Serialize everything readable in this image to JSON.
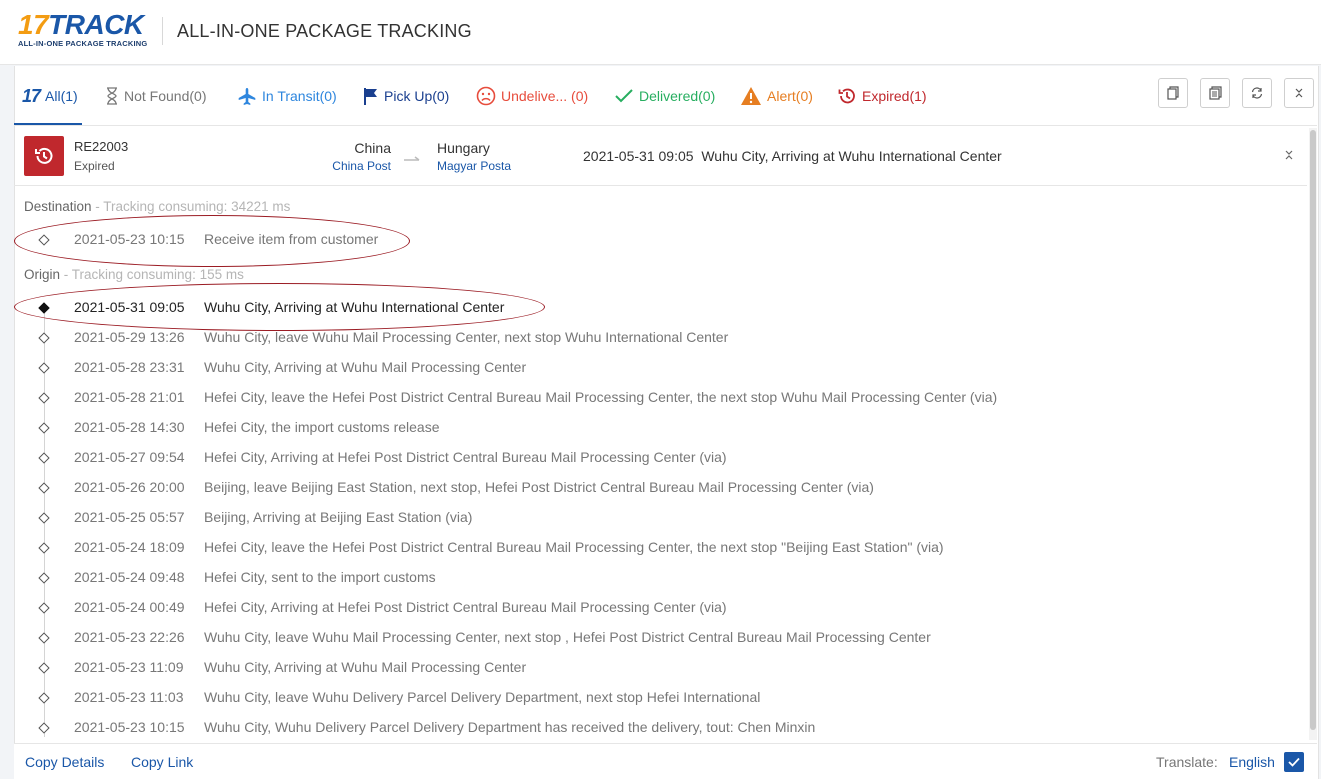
{
  "header": {
    "logo_main": "17TRACK",
    "logo_sub": "ALL-IN-ONE PACKAGE TRACKING",
    "title": "ALL-IN-ONE PACKAGE TRACKING"
  },
  "tabs": [
    {
      "id": "all",
      "label": "All(1)",
      "color": "#1a57a8",
      "icon": "17-logo-icon",
      "active": true
    },
    {
      "id": "not-found",
      "label": "Not Found(0)",
      "color": "#777777",
      "icon": "hourglass-icon"
    },
    {
      "id": "in-transit",
      "label": "In Transit(0)",
      "color": "#2e86de",
      "icon": "airplane-icon"
    },
    {
      "id": "pick-up",
      "label": "Pick Up(0)",
      "color": "#1a3f8f",
      "icon": "flag-icon"
    },
    {
      "id": "undelivered",
      "label": "Undelive... (0)",
      "color": "#e74c3c",
      "icon": "sad-face-icon"
    },
    {
      "id": "delivered",
      "label": "Delivered(0)",
      "color": "#27ae60",
      "icon": "checkmark-icon"
    },
    {
      "id": "alert",
      "label": "Alert(0)",
      "color": "#e67e22",
      "icon": "warning-icon"
    },
    {
      "id": "expired",
      "label": "Expired(1)",
      "color": "#c0282d",
      "icon": "history-icon"
    }
  ],
  "package": {
    "number": "RE22003\b",
    "status": "Expired",
    "origin_country": "China",
    "origin_carrier": "China Post",
    "dest_country": "Hungary",
    "dest_carrier": "Magyar Posta",
    "latest_time": "2021-05-31 09:05",
    "latest_desc": "Wuhu City, Arriving at Wuhu International Center"
  },
  "destination": {
    "label": "Destination",
    "consuming": " - Tracking consuming: 34221 ms",
    "events": [
      {
        "time": "2021-05-23 10:15",
        "desc": "Receive item from customer"
      }
    ]
  },
  "origin": {
    "label": "Origin",
    "consuming": " - Tracking consuming: 155 ms",
    "events": [
      {
        "time": "2021-05-31 09:05",
        "desc": "Wuhu City, Arriving at Wuhu International Center"
      },
      {
        "time": "2021-05-29 13:26",
        "desc": "Wuhu City, leave Wuhu Mail Processing Center, next stop Wuhu International Center"
      },
      {
        "time": "2021-05-28 23:31",
        "desc": "Wuhu City, Arriving at Wuhu Mail Processing Center"
      },
      {
        "time": "2021-05-28 21:01",
        "desc": "Hefei City, leave the Hefei Post District Central Bureau Mail Processing Center, the next stop Wuhu Mail Processing Center (via)"
      },
      {
        "time": "2021-05-28 14:30",
        "desc": "Hefei City, the import customs release"
      },
      {
        "time": "2021-05-27 09:54",
        "desc": "Hefei City, Arriving at Hefei Post District Central Bureau Mail Processing Center (via)"
      },
      {
        "time": "2021-05-26 20:00",
        "desc": "Beijing, leave Beijing East Station, next stop, Hefei Post District Central Bureau Mail Processing Center (via)"
      },
      {
        "time": "2021-05-25 05:57",
        "desc": "Beijing, Arriving at Beijing East Station (via)"
      },
      {
        "time": "2021-05-24 18:09",
        "desc": "Hefei City, leave the Hefei Post District Central Bureau Mail Processing Center, the next stop \"Beijing East Station\" (via)"
      },
      {
        "time": "2021-05-24 09:48",
        "desc": "Hefei City, sent to the import customs"
      },
      {
        "time": "2021-05-24 00:49",
        "desc": "Hefei City, Arriving at Hefei Post District Central Bureau Mail Processing Center (via)"
      },
      {
        "time": "2021-05-23 22:26",
        "desc": "Wuhu City, leave Wuhu Mail Processing Center, next stop , Hefei Post District Central Bureau Mail Processing Center"
      },
      {
        "time": "2021-05-23 11:09",
        "desc": "Wuhu City, Arriving at Wuhu Mail Processing Center"
      },
      {
        "time": "2021-05-23 11:03",
        "desc": "Wuhu City, leave Wuhu Delivery Parcel Delivery Department, next stop Hefei International"
      },
      {
        "time": "2021-05-23 10:15",
        "desc": "Wuhu City, Wuhu Delivery Parcel Delivery Department has received the delivery, tout: Chen Minxin"
      }
    ]
  },
  "footer": {
    "copy_details": "Copy Details",
    "copy_link": "Copy Link",
    "translate_label": "Translate:",
    "translate_lang": "English"
  },
  "colors": {
    "brand": "#1a57a8",
    "expired": "#c0282d",
    "annotation": "#9b1c24"
  }
}
